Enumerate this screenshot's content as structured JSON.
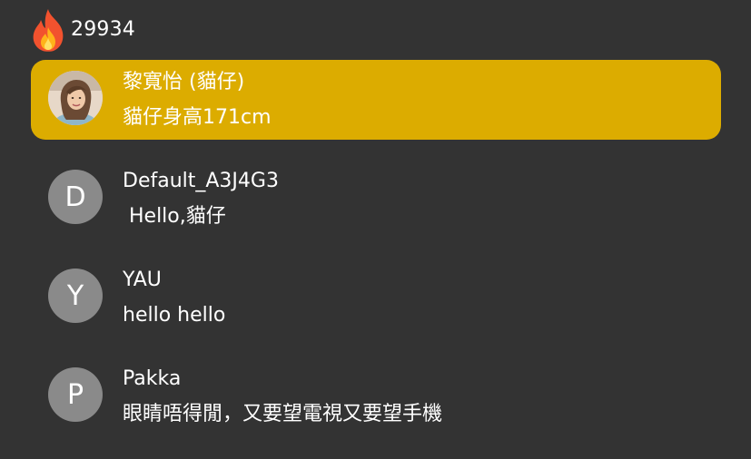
{
  "header": {
    "icon": "fire-icon",
    "viewer_count": "29934"
  },
  "colors": {
    "background": "#333333",
    "highlight": "#dcac00",
    "avatar_placeholder": "#8a8a8a"
  },
  "messages": [
    {
      "author": "黎寬怡 (貓仔)",
      "text": "貓仔身高171cm",
      "avatar": "profile-photo",
      "highlighted": true
    },
    {
      "author": "Default_A3J4G3",
      "text": " Hello,貓仔",
      "avatar_letter": "D",
      "highlighted": false
    },
    {
      "author": "YAU",
      "text": "hello hello",
      "avatar_letter": "Y",
      "highlighted": false
    },
    {
      "author": "Pakka",
      "text": "眼睛唔得閒，又要望電視又要望手機",
      "avatar_letter": "P",
      "highlighted": false
    }
  ]
}
